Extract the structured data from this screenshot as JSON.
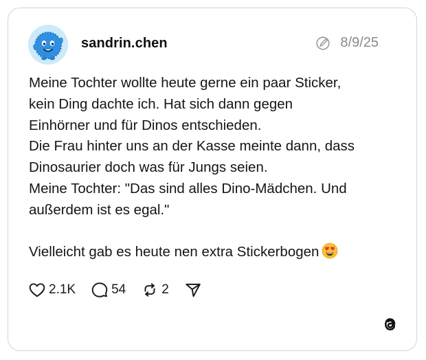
{
  "post": {
    "author": {
      "username": "sandrin.chen",
      "avatar_icon": "blue-fuzzy-creature-avatar"
    },
    "edited_icon": "edited-pencil-icon",
    "date": "8/9/25",
    "text_lines": [
      "Meine Tochter wollte heute gerne ein paar Sticker,",
      "kein Ding dachte ich. Hat sich dann gegen",
      "Einhörner und für Dinos entschieden.",
      "Die Frau hinter uns an der Kasse meinte dann, dass",
      "Dinosaurier doch was für Jungs seien.",
      "Meine Tochter: \"Das sind alles Dino-Mädchen. Und",
      "außerdem ist es egal.\"",
      "",
      "Vielleicht gab es heute nen extra Stickerbogen"
    ],
    "emoji": "heart-eyes-emoji",
    "stats": {
      "likes": "2.1K",
      "replies": "54",
      "reposts": "2"
    }
  },
  "brand": {
    "logo_icon": "threads-logo-icon"
  }
}
